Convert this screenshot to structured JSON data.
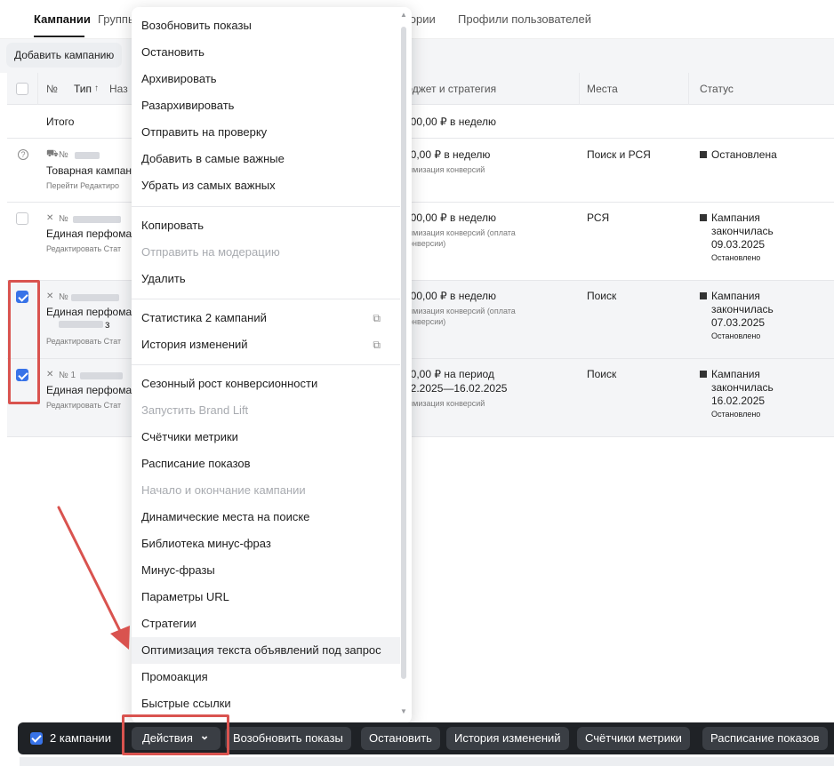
{
  "tabs": [
    {
      "label": "Кампании"
    },
    {
      "label": "Группы"
    },
    {
      "label": "тории"
    },
    {
      "label": "Профили пользователей"
    }
  ],
  "toolbar": {
    "add_campaign": "Добавить кампанию"
  },
  "table": {
    "headers": {
      "num": "№",
      "type": "Тип",
      "sort_icon": "↑",
      "name": "Наз",
      "budget": "юджет и стратегия",
      "places": "Места",
      "status": "Статус"
    },
    "total": {
      "label": "Итого",
      "budget": "500,00 ₽ в неделю"
    },
    "rows": [
      {
        "icon": "⛟",
        "num": "№",
        "name": "Товарная кампани",
        "links": "Перейти  Редактиро",
        "budget": "00,00 ₽ в неделю",
        "strategy": "тимизация конверсий",
        "places": "Поиск и РСЯ",
        "status": "Остановлена",
        "status_sub": ""
      },
      {
        "icon": "✕",
        "num": "№",
        "name": "Единая перфоман",
        "links": "Редактировать  Стат",
        "budget": "000,00 ₽ в неделю",
        "strategy": "тимизация конверсий (оплата",
        "strategy2": "конверсии)",
        "places": "РСЯ",
        "status_lines": [
          "Кампания",
          "закончилась",
          "09.03.2025"
        ],
        "status_sub": "Остановлено"
      },
      {
        "icon": "✕",
        "num": "№",
        "name": "Единая перфоман",
        "name_tail": "з",
        "links": "Редактировать  Стат",
        "budget": "000,00 ₽ в неделю",
        "strategy": "тимизация конверсий (оплата",
        "strategy2": "конверсии)",
        "places": "Поиск",
        "status_lines": [
          "Кампания",
          "закончилась",
          "07.03.2025"
        ],
        "status_sub": "Остановлено"
      },
      {
        "icon": "✕",
        "num": "№ 1",
        "name": "Единая перфоман",
        "links": "Редактировать  Стат",
        "budget": "00,00 ₽ на период",
        "budget2": "02.2025—16.02.2025",
        "strategy": "тимизация конверсий",
        "places": "Поиск",
        "status_lines": [
          "Кампания",
          "закончилась",
          "16.02.2025"
        ],
        "status_sub": "Остановлено"
      }
    ]
  },
  "menu": {
    "items": [
      {
        "label": "Возобновить показы"
      },
      {
        "label": "Остановить"
      },
      {
        "label": "Архивировать"
      },
      {
        "label": "Разархивировать"
      },
      {
        "label": "Отправить на проверку"
      },
      {
        "label": "Добавить в самые важные"
      },
      {
        "label": "Убрать из самых важных"
      },
      {
        "label": "Копировать"
      },
      {
        "label": "Отправить на модерацию",
        "disabled": true
      },
      {
        "label": "Удалить"
      },
      {
        "label": "Статистика 2 кампаний",
        "external": "⧉"
      },
      {
        "label": "История изменений",
        "external": "⧉"
      },
      {
        "label": "Сезонный рост конверсионности"
      },
      {
        "label": "Запустить Brand Lift",
        "disabled": true
      },
      {
        "label": "Счётчики метрики"
      },
      {
        "label": "Расписание показов"
      },
      {
        "label": "Начало и окончание кампании",
        "disabled": true
      },
      {
        "label": "Динамические места на поиске"
      },
      {
        "label": "Библиотека минус-фраз"
      },
      {
        "label": "Минус-фразы"
      },
      {
        "label": "Параметры URL"
      },
      {
        "label": "Стратегии"
      },
      {
        "label": "Оптимизация текста объявлений под запрос",
        "hover": true
      },
      {
        "label": "Промоакция"
      },
      {
        "label": "Быстрые ссылки"
      }
    ]
  },
  "actionbar": {
    "count": "2 кампании",
    "actions": "Действия",
    "chevron": "⌄",
    "buttons": [
      "Возобновить показы",
      "Остановить",
      "История изменений",
      "Счётчики метрики",
      "Расписание показов"
    ]
  },
  "colors": {
    "accent": "#3873e8",
    "annotation": "#d9534f",
    "bar": "#1f2226"
  }
}
